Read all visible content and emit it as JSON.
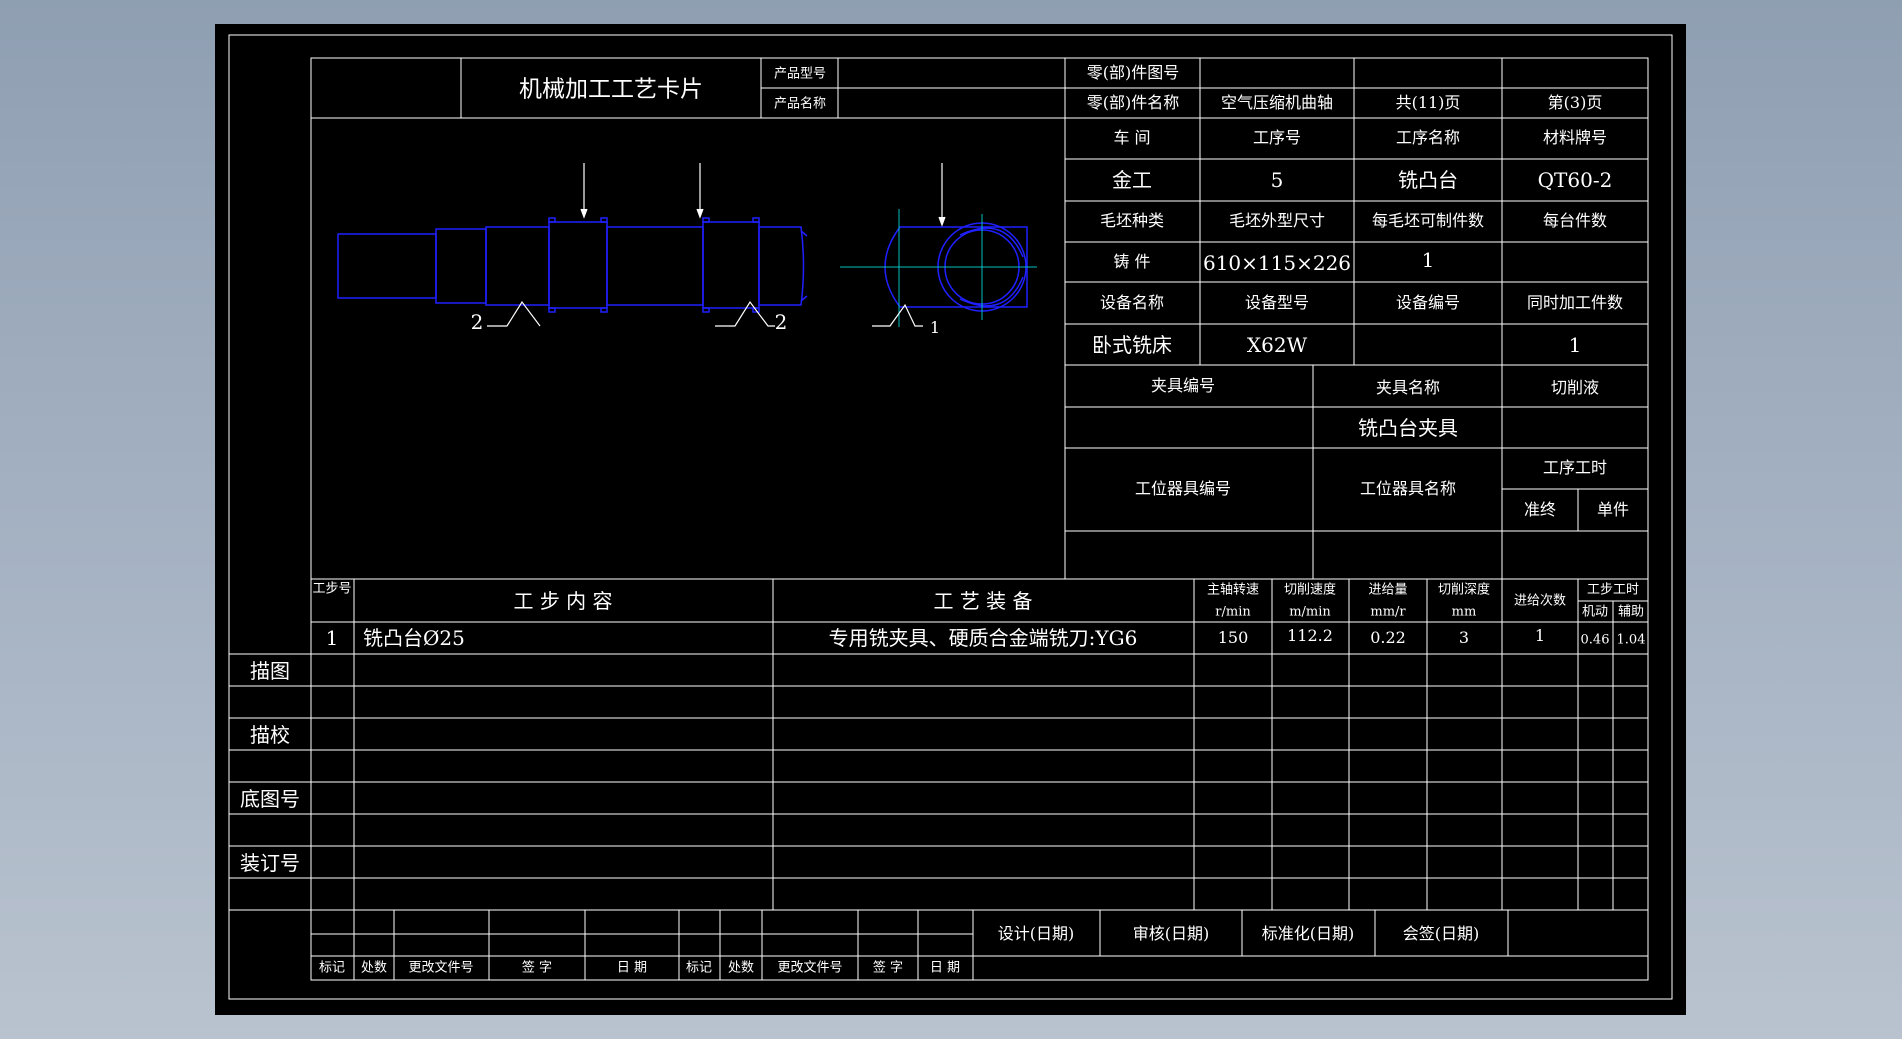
{
  "title_block": {
    "card_title": "机械加工工艺卡片",
    "product_model_label": "产品型号",
    "product_name_label": "产品名称",
    "part_drawing_no_label": "零(部)件图号",
    "part_name_label": "零(部)件名称",
    "part_name": "空气压缩机曲轴",
    "total_pages": "共(11)页",
    "page_no": "第(3)页"
  },
  "process_info": {
    "workshop_label": "车  间",
    "op_no_label": "工序号",
    "op_name_label": "工序名称",
    "material_label": "材料牌号",
    "workshop": "金工",
    "op_no": "5",
    "op_name": "铣凸台",
    "material": "QT60-2",
    "blank_type_label": "毛坯种类",
    "blank_size_label": "毛坯外型尺寸",
    "parts_per_blank_label": "每毛坯可制件数",
    "parts_per_unit_label": "每台件数",
    "blank_type": "铸  件",
    "blank_size": "610×115×226",
    "parts_per_blank": "1",
    "equip_name_label": "设备名称",
    "equip_model_label": "设备型号",
    "equip_no_label": "设备编号",
    "simultaneous_label": "同时加工件数",
    "equip_name": "卧式铣床",
    "equip_model": "X62W",
    "simultaneous": "1",
    "fixture_no_label": "夹具编号",
    "fixture_name_label": "夹具名称",
    "coolant_label": "切削液",
    "fixture_name": "铣凸台夹具",
    "station_tool_no_label": "工位器具编号",
    "station_tool_name_label": "工位器具名称",
    "op_time_label": "工序工时",
    "prep_label": "准终",
    "unit_label": "单件"
  },
  "sketch_labels": {
    "left_support": "2",
    "right_support": "2",
    "side_support": "1"
  },
  "steps_table": {
    "headers": {
      "step_no": "工步号",
      "content": "工  步  内  容",
      "equipment": "工  艺  装  备",
      "spindle_speed": "主轴转速",
      "spindle_unit": "r/min",
      "cut_speed": "切削速度",
      "cut_speed_unit": "m/min",
      "feed": "进给量",
      "feed_unit": "mm/r",
      "depth": "切削深度",
      "depth_unit": "mm",
      "passes": "进给次数",
      "step_time": "工步工时",
      "machine_time": "机动",
      "aux_time": "辅助"
    },
    "rows": [
      {
        "step_no": "1",
        "content": "铣凸台Ø25",
        "equipment": "专用铣夹具、硬质合金端铣刀:YG6",
        "spindle_speed": "150",
        "cut_speed": "112.2",
        "feed": "0.22",
        "depth": "3",
        "passes": "1",
        "machine_time": "0.46",
        "aux_time": "1.04"
      }
    ]
  },
  "side_labels": {
    "trace": "描图",
    "trace_check": "描校",
    "base_drawing_no": "底图号",
    "binding_no": "装订号"
  },
  "signature_block": {
    "design": "设计(日期)",
    "review": "审核(日期)",
    "standardize": "标准化(日期)",
    "countersign": "会签(日期)",
    "mark": "标记",
    "count": "处数",
    "change_doc_no": "更改文件号",
    "signature": "签  字",
    "date": "日  期",
    "mark2": "标记",
    "count2": "处数",
    "change_doc_no2": "更改文件号",
    "signature2": "签  字",
    "date2": "日  期"
  },
  "colors": {
    "background": "#000000",
    "lines": "#ffffff",
    "part_outline": "#2020ff",
    "center_lines": "#00c0c0"
  }
}
